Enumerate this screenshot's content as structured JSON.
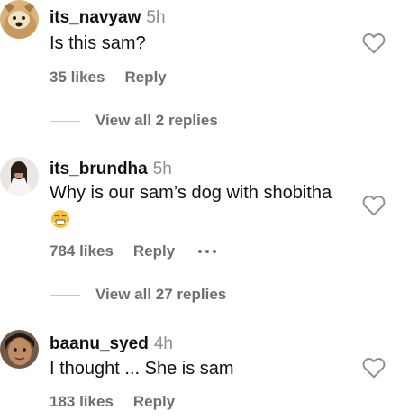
{
  "comments": [
    {
      "username": "its_navyaw",
      "time": "5h",
      "text": "Is this sam?",
      "likes": "35 likes",
      "reply": "Reply",
      "view_replies": "View all 2 replies"
    },
    {
      "username": "its_brundha",
      "time": "5h",
      "text": "Why is our sam’s dog with shobitha",
      "emoji": "😤",
      "likes": "784 likes",
      "reply": "Reply",
      "view_replies": "View all 27 replies"
    },
    {
      "username": "baanu_syed",
      "time": "4h",
      "text": "I thought ... She is sam",
      "likes": "183 likes",
      "reply": "Reply"
    }
  ],
  "icons": {
    "like": "heart-outline-icon",
    "more": "more-horizontal-icon"
  },
  "colors": {
    "username": "#111111",
    "secondary_text": "#8e8e8e",
    "action_text": "#6f6f6f"
  }
}
